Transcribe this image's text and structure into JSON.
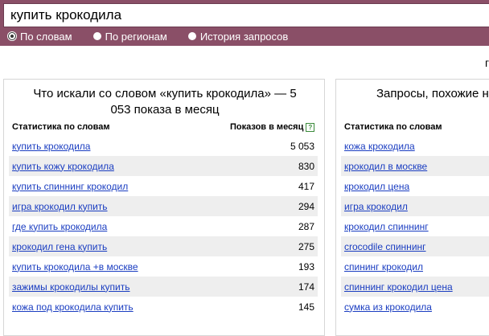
{
  "search": {
    "value": "купить крокодила"
  },
  "modes": [
    {
      "label": "По словам",
      "selected": true
    },
    {
      "label": "По регионам",
      "selected": false
    },
    {
      "label": "История запросов",
      "selected": false
    }
  ],
  "edge_char": "г",
  "left_panel": {
    "title": "Что искали со словом «купить крокодила» — 5 053 показа в месяц",
    "col_words": "Статистика по словам",
    "col_count": "Показов в месяц",
    "help": "?",
    "rows": [
      {
        "query": "купить крокодила",
        "count": "5 053"
      },
      {
        "query": "купить кожу крокодила",
        "count": "830"
      },
      {
        "query": "купить спиннинг крокодил",
        "count": "417"
      },
      {
        "query": "игра крокодил купить",
        "count": "294"
      },
      {
        "query": "где купить крокодила",
        "count": "287"
      },
      {
        "query": "крокодил гена купить",
        "count": "275"
      },
      {
        "query": "купить крокодила +в москве",
        "count": "193"
      },
      {
        "query": "зажимы крокодилы купить",
        "count": "174"
      },
      {
        "query": "кожа под крокодила купить",
        "count": "145"
      }
    ]
  },
  "right_panel": {
    "title": "Запросы, похожие на",
    "col_words": "Статистика по словам",
    "rows": [
      {
        "query": "кожа крокодила"
      },
      {
        "query": "крокодил в москве"
      },
      {
        "query": "крокодил цена"
      },
      {
        "query": "игра крокодил"
      },
      {
        "query": "крокодил спиннинг"
      },
      {
        "query": "crocodile спиннинг"
      },
      {
        "query": "спининг крокодил"
      },
      {
        "query": "спиннинг крокодил цена"
      },
      {
        "query": "сумка из крокодила"
      }
    ]
  }
}
